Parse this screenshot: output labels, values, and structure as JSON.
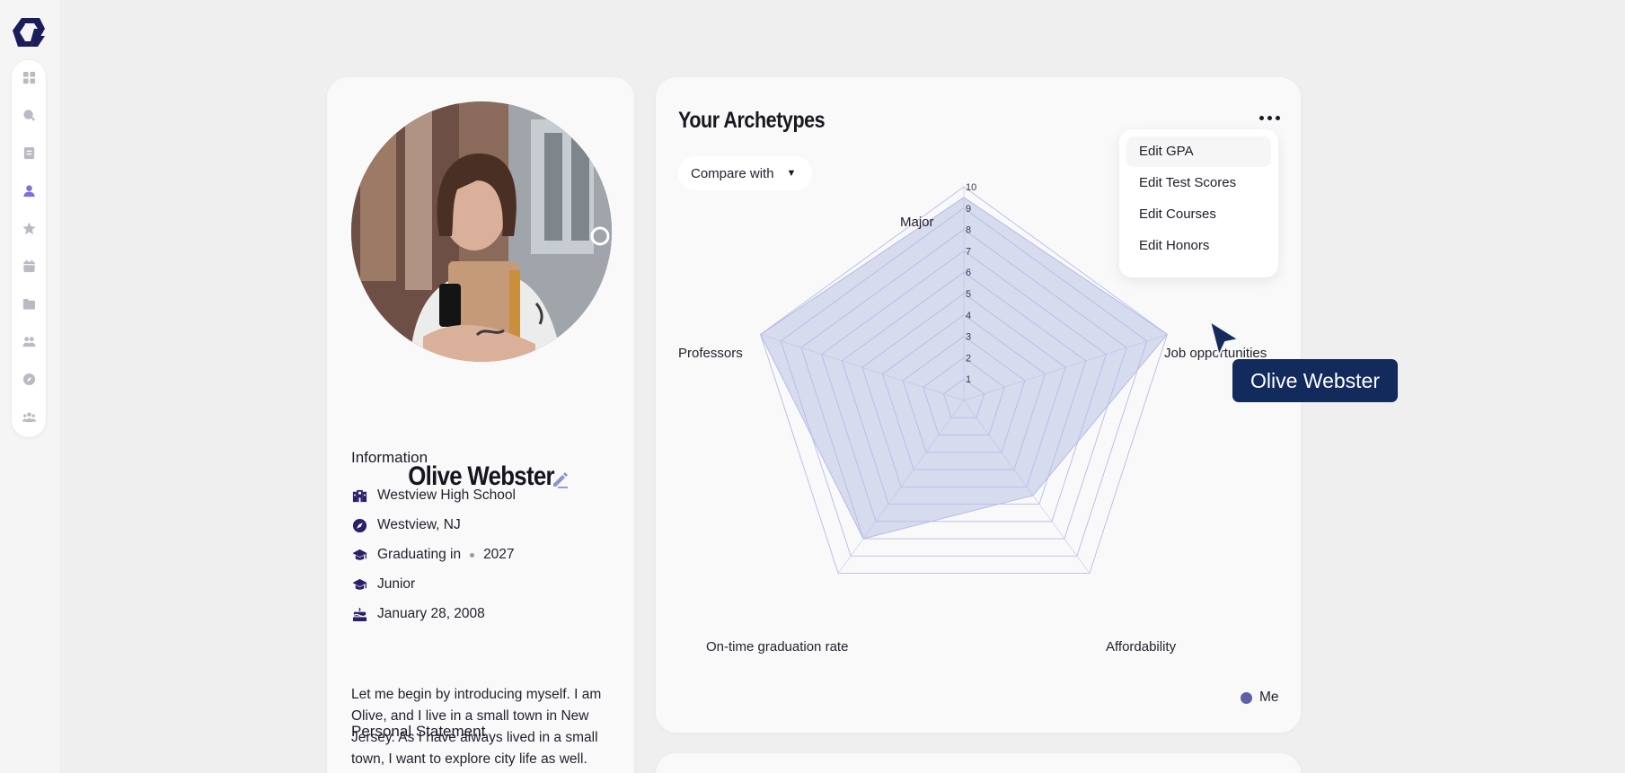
{
  "sidebar": {
    "logo_icon": "app-logo",
    "items": [
      {
        "icon": "grid-icon",
        "label": "Dashboard"
      },
      {
        "icon": "search-icon",
        "label": "Search"
      },
      {
        "icon": "document-icon",
        "label": "Documents"
      },
      {
        "icon": "user-icon",
        "label": "Profile",
        "active": true
      },
      {
        "icon": "star-icon",
        "label": "Favorites"
      },
      {
        "icon": "calendar-icon",
        "label": "Calendar"
      },
      {
        "icon": "folder-icon",
        "label": "Folders"
      },
      {
        "icon": "group-icon",
        "label": "Groups"
      },
      {
        "icon": "compass-icon",
        "label": "Explore"
      },
      {
        "icon": "community-icon",
        "label": "Community"
      }
    ]
  },
  "profile": {
    "name": "Olive Webster",
    "information_title": "Information",
    "info": {
      "school": "Westview High School",
      "location": "Westview, NJ",
      "graduating_label": "Graduating in",
      "graduating_year": "2027",
      "grade": "Junior",
      "birthday": "January 28, 2008"
    },
    "statement_title": "Personal Statement",
    "statement": "Let me begin by introducing myself. I am Olive, and I live in a small town in New Jersey. As I have always lived in a small town, I want to explore city life as well."
  },
  "archetypes": {
    "title": "Your Archetypes",
    "compare_label": "Compare with",
    "menu": [
      "Edit GPA",
      "Edit Test Scores",
      "Edit Courses",
      "Edit Honors"
    ]
  },
  "chart_data": {
    "type": "radar",
    "axes": [
      "Major",
      "Job opportunities",
      "Affordability",
      "On-time graduation rate",
      "Professors"
    ],
    "scale_ticks": [
      "1",
      "2",
      "3",
      "4",
      "5",
      "6",
      "7",
      "8",
      "9",
      "10"
    ],
    "range": [
      0,
      10
    ],
    "series": [
      {
        "name": "Me",
        "values": [
          9.5,
          10,
          5.5,
          8,
          10
        ],
        "color": "#5e60a8"
      }
    ],
    "legend_placement": "bottom-right"
  },
  "overlay": {
    "tooltip": "Olive Webster"
  },
  "colors": {
    "accent": "#5e60a8",
    "fill": "#d3d7ec",
    "grid": "#b8bae8",
    "tooltip_bg": "#132a5c",
    "icon": "#2b1f6b"
  }
}
